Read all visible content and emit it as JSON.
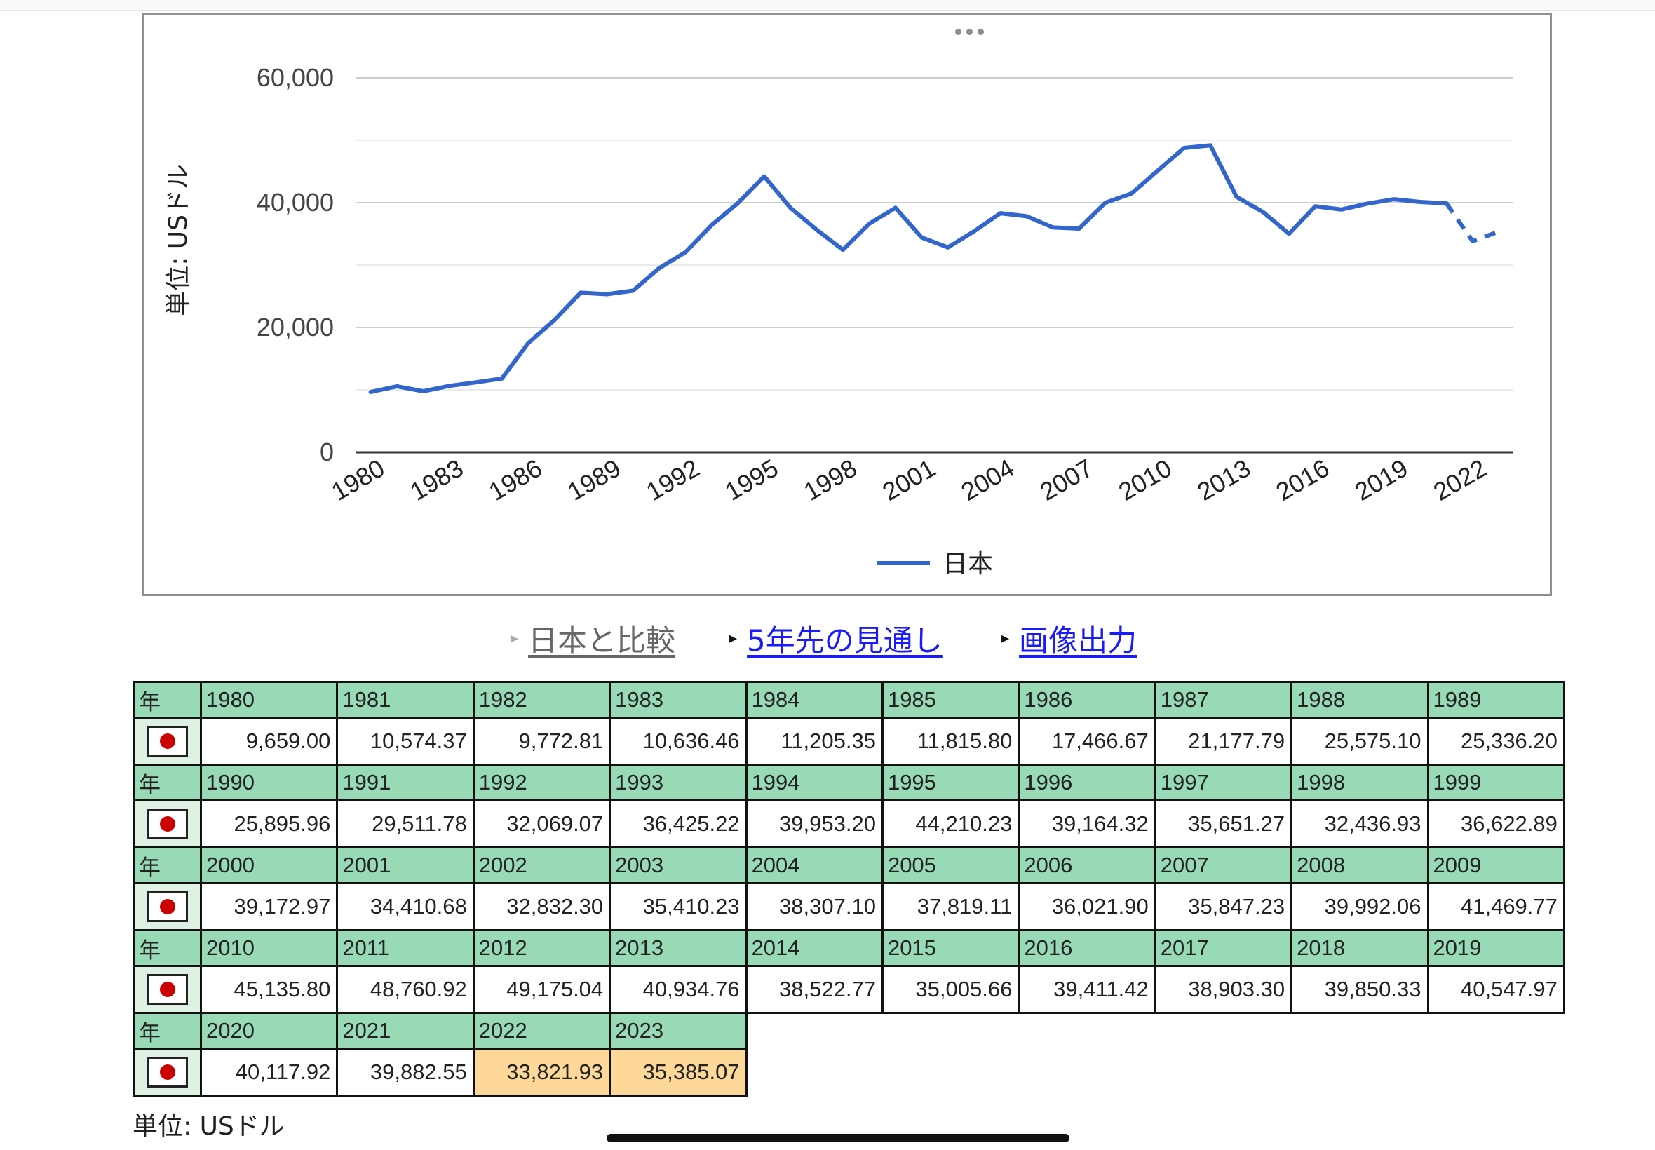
{
  "chart_data": {
    "type": "line",
    "title": "",
    "xlabel": "",
    "ylabel": "単位: USドル",
    "ylim": [
      0,
      60000
    ],
    "yticks": [
      "0",
      "20,000",
      "40,000",
      "60,000"
    ],
    "grid": true,
    "legend_position": "bottom",
    "x": [
      1980,
      1981,
      1982,
      1983,
      1984,
      1985,
      1986,
      1987,
      1988,
      1989,
      1990,
      1991,
      1992,
      1993,
      1994,
      1995,
      1996,
      1997,
      1998,
      1999,
      2000,
      2001,
      2002,
      2003,
      2004,
      2005,
      2006,
      2007,
      2008,
      2009,
      2010,
      2011,
      2012,
      2013,
      2014,
      2015,
      2016,
      2017,
      2018,
      2019,
      2020,
      2021,
      2022,
      2023
    ],
    "xtick_labels": [
      "1980",
      "1983",
      "1986",
      "1989",
      "1992",
      "1995",
      "1998",
      "2001",
      "2004",
      "2007",
      "2010",
      "2013",
      "2016",
      "2019",
      "2022"
    ],
    "series": [
      {
        "name": "日本",
        "color": "#3366cc",
        "values": [
          9659.0,
          10574.37,
          9772.81,
          10636.46,
          11205.35,
          11815.8,
          17466.67,
          21177.79,
          25575.1,
          25336.2,
          25895.96,
          29511.78,
          32069.07,
          36425.22,
          39953.2,
          44210.23,
          39164.32,
          35651.27,
          32436.93,
          36622.89,
          39172.97,
          34410.68,
          32832.3,
          35410.23,
          38307.1,
          37819.11,
          36021.9,
          35847.23,
          39992.06,
          41469.77,
          45135.8,
          48760.92,
          49175.04,
          40934.76,
          38522.77,
          35005.66,
          39411.42,
          38903.3,
          39850.33,
          40547.97,
          40117.92,
          39882.55,
          33821.93,
          35385.07
        ],
        "forecast_from": 2021
      }
    ]
  },
  "links": [
    {
      "label": "日本と比較",
      "color": "#666666"
    },
    {
      "label": "5年先の見通し",
      "color": "#1a1aff"
    },
    {
      "label": "画像出力",
      "color": "#1a1aff"
    }
  ],
  "table": {
    "year_header": "年",
    "country_icon": "japan-flag-icon",
    "header_color": "#98d9b6",
    "forecast_color": "#fdd899",
    "rows": [
      {
        "years": [
          "1980",
          "1981",
          "1982",
          "1983",
          "1984",
          "1985",
          "1986",
          "1987",
          "1988",
          "1989"
        ],
        "values": [
          "9,659.00",
          "10,574.37",
          "9,772.81",
          "10,636.46",
          "11,205.35",
          "11,815.80",
          "17,466.67",
          "21,177.79",
          "25,575.10",
          "25,336.20"
        ],
        "forecast": []
      },
      {
        "years": [
          "1990",
          "1991",
          "1992",
          "1993",
          "1994",
          "1995",
          "1996",
          "1997",
          "1998",
          "1999"
        ],
        "values": [
          "25,895.96",
          "29,511.78",
          "32,069.07",
          "36,425.22",
          "39,953.20",
          "44,210.23",
          "39,164.32",
          "35,651.27",
          "32,436.93",
          "36,622.89"
        ],
        "forecast": []
      },
      {
        "years": [
          "2000",
          "2001",
          "2002",
          "2003",
          "2004",
          "2005",
          "2006",
          "2007",
          "2008",
          "2009"
        ],
        "values": [
          "39,172.97",
          "34,410.68",
          "32,832.30",
          "35,410.23",
          "38,307.10",
          "37,819.11",
          "36,021.90",
          "35,847.23",
          "39,992.06",
          "41,469.77"
        ],
        "forecast": []
      },
      {
        "years": [
          "2010",
          "2011",
          "2012",
          "2013",
          "2014",
          "2015",
          "2016",
          "2017",
          "2018",
          "2019"
        ],
        "values": [
          "45,135.80",
          "48,760.92",
          "49,175.04",
          "40,934.76",
          "38,522.77",
          "35,005.66",
          "39,411.42",
          "38,903.30",
          "39,850.33",
          "40,547.97"
        ],
        "forecast": []
      },
      {
        "years": [
          "2020",
          "2021",
          "2022",
          "2023"
        ],
        "values": [
          "40,117.92",
          "39,882.55",
          "33,821.93",
          "35,385.07"
        ],
        "forecast": [
          2,
          3
        ]
      }
    ]
  },
  "unit_note": "単位: USドル"
}
